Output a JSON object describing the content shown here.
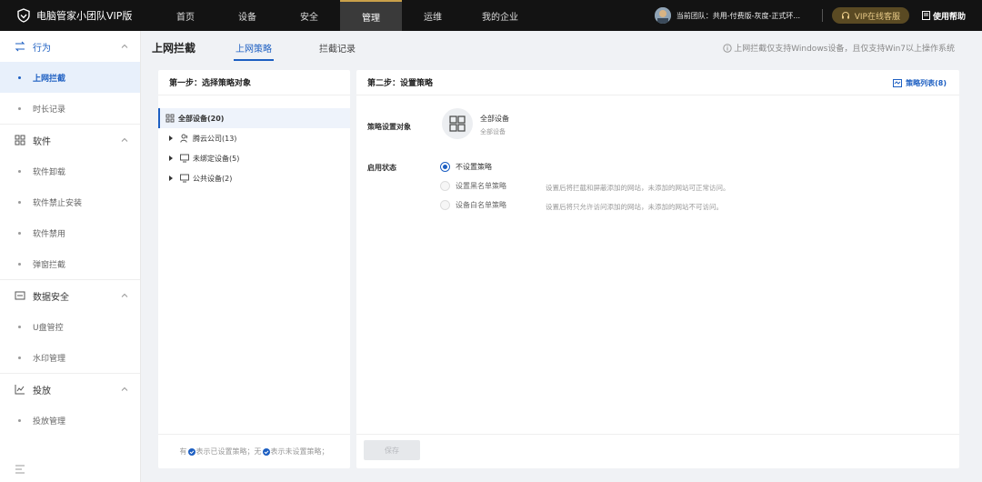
{
  "app": {
    "title": "电脑管家小团队VIP版"
  },
  "nav": [
    {
      "label": "首页"
    },
    {
      "label": "设备"
    },
    {
      "label": "安全"
    },
    {
      "label": "管理"
    },
    {
      "label": "运维"
    },
    {
      "label": "我的企业"
    }
  ],
  "active_nav": "管理",
  "header": {
    "team": "当前团队：共用-付费版-灰度-正式环...",
    "vip": "VIP在线客服",
    "help": "使用帮助"
  },
  "sidebar": {
    "groups": [
      {
        "label": "行为",
        "icon": "behavior-icon",
        "items": [
          {
            "label": "上网拦截"
          },
          {
            "label": "时长记录"
          }
        ]
      },
      {
        "label": "软件",
        "icon": "grid-icon",
        "items": [
          {
            "label": "软件卸载"
          },
          {
            "label": "软件禁止安装"
          },
          {
            "label": "软件禁用"
          },
          {
            "label": "弹窗拦截"
          }
        ]
      },
      {
        "label": "数据安全",
        "icon": "data-security-icon",
        "items": [
          {
            "label": "U盘管控"
          },
          {
            "label": "水印管理"
          }
        ]
      },
      {
        "label": "投放",
        "icon": "chart-icon",
        "items": [
          {
            "label": "投放管理"
          }
        ]
      }
    ],
    "active_item": "上网拦截"
  },
  "page": {
    "title": "上网拦截",
    "tabs": [
      {
        "label": "上网策略"
      },
      {
        "label": "拦截记录"
      }
    ],
    "active_tab": "上网策略",
    "notice": "上网拦截仅支持Windows设备，且仅支持Win7以上操作系统"
  },
  "left_panel": {
    "title": "第一步：选择策略对象",
    "tree": {
      "root": "全部设备(20)",
      "children": [
        {
          "label": "腾云公司(13)",
          "icon": "user-group-icon"
        },
        {
          "label": "未绑定设备(5)",
          "icon": "monitor-icon"
        },
        {
          "label": "公共设备(2)",
          "icon": "monitor-icon"
        }
      ]
    },
    "legend": {
      "has": "有",
      "has_text": "表示已设置策略；",
      "none": "无",
      "none_text": "表示未设置策略；"
    }
  },
  "right_panel": {
    "title": "第二步：设置策略",
    "policy_list": "策略列表(8)",
    "target_label": "策略设置对象",
    "target_name": "全部设备",
    "target_sub": "全部设备",
    "status_label": "启用状态",
    "options": [
      {
        "label": "不设置策略",
        "desc": "",
        "selected": true
      },
      {
        "label": "设置黑名单策略",
        "desc": "设置后将拦截和屏蔽添加的网站，未添加的网站可正常访问。",
        "selected": false
      },
      {
        "label": "设备白名单策略",
        "desc": "设置后将只允许访问添加的网站，未添加的网站不可访问。",
        "selected": false
      }
    ],
    "save": "保存"
  },
  "colors": {
    "accent": "#1d5fc2",
    "topbar": "#131313",
    "vip": "#e7c987"
  }
}
